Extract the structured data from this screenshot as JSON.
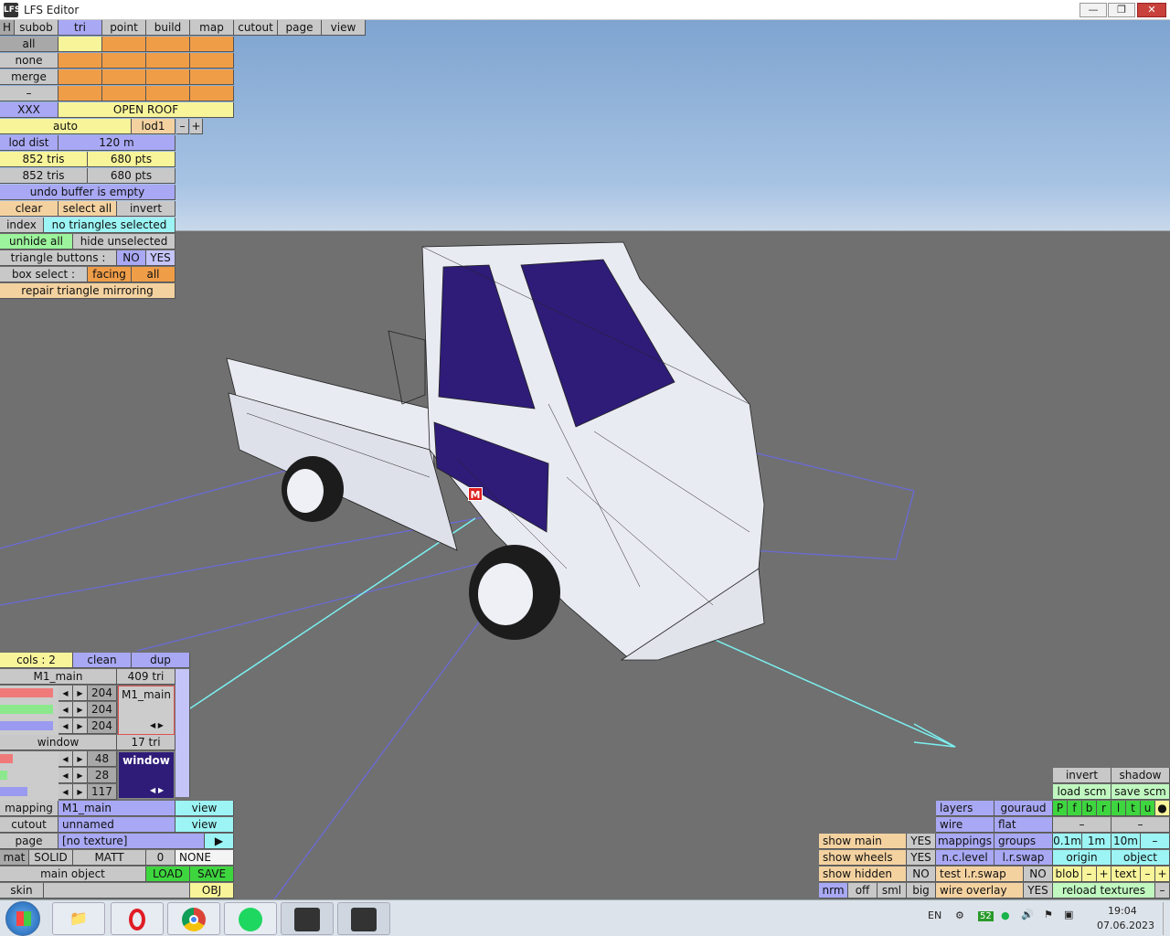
{
  "window": {
    "title": "LFS Editor",
    "icon": "lfs-app-icon",
    "minimize": "—",
    "restore": "❐",
    "close": "✕"
  },
  "menu": {
    "h": "H",
    "items": [
      "subob",
      "tri",
      "point",
      "build",
      "map",
      "cutout",
      "page",
      "view"
    ]
  },
  "left_panel": {
    "all": "all",
    "none": "none",
    "merge": "merge",
    "dash": "–",
    "xxx": "XXX",
    "open_roof": "OPEN ROOF",
    "auto": "auto",
    "lod1": "lod1",
    "minus": "–",
    "plus": "+",
    "lod_dist_label": "lod dist",
    "lod_dist_value": "120 m",
    "tris1": "852 tris",
    "pts1": "680 pts",
    "tris2": "852 tris",
    "pts2": "680 pts",
    "undo": "undo buffer is empty",
    "clear": "clear",
    "select_all": "select all",
    "invert": "invert",
    "index": "index",
    "no_selection": "no triangles selected",
    "unhide_all": "unhide all",
    "hide_unselected": "hide unselected",
    "triangle_buttons": "triangle buttons :",
    "no": "NO",
    "yes": "YES",
    "box_select": "box select :",
    "facing": "facing",
    "all2": "all",
    "repair": "repair triangle mirroring"
  },
  "materials": {
    "cols": "cols : 2",
    "clean": "clean",
    "dup": "dup",
    "m1_name": "M1_main",
    "m1_tri": "409 tri",
    "m1_r": "204",
    "m1_g": "204",
    "m1_b": "204",
    "m1_preview": "M1_main",
    "w_name": "window",
    "w_tri": "17 tri",
    "w_r": "48",
    "w_g": "28",
    "w_b": "117",
    "w_preview": "window",
    "mapping_label": "mapping",
    "mapping_value": "M1_main",
    "view1": "view",
    "cutout_label": "cutout",
    "cutout_value": "unnamed",
    "view2": "view",
    "page_label": "page",
    "page_value": "[no texture]",
    "page_arrow": "▶",
    "mat": "mat",
    "solid": "SOLID",
    "matt": "MATT",
    "zero": "0",
    "none": "NONE",
    "main_object": "main object",
    "load": "LOAD",
    "save": "SAVE",
    "skin": "skin",
    "obj": "OBJ"
  },
  "right_panel": {
    "invert": "invert",
    "shadow": "shadow",
    "load_scm": "load scm",
    "save_scm": "save scm",
    "layers": "layers",
    "gouraud": "gouraud",
    "letters": [
      "P",
      "f",
      "b",
      "r",
      "l",
      "t",
      "u",
      "●"
    ],
    "wire": "wire",
    "flat": "flat",
    "dash1": "–",
    "dash2": "–",
    "show_main": "show main",
    "yes1": "YES",
    "mappings": "mappings",
    "groups": "groups",
    "d01": "0.1m",
    "d1": "1m",
    "d10": "10m",
    "dm": "–",
    "show_wheels": "show wheels",
    "yes2": "YES",
    "nclevel": "n.c.level",
    "lrswap": "l.r.swap",
    "origin": "origin",
    "object": "object",
    "show_hidden": "show hidden",
    "no1": "NO",
    "test_lrswap": "test l.r.swap",
    "no2": "NO",
    "blob": "blob",
    "bm": "–",
    "bp": "+",
    "text": "text",
    "tm": "–",
    "tp": "+",
    "nrm": "nrm",
    "off": "off",
    "sml": "sml",
    "big": "big",
    "wire_overlay": "wire overlay",
    "yes3": "YES",
    "reload": "reload textures",
    "rd": "–"
  },
  "marker": "M",
  "taskbar": {
    "lang": "EN",
    "badge": "52",
    "time": "19:04",
    "date": "07.06.2023"
  },
  "colors": {
    "window_mat": "#2e1c78",
    "truck": "#e9ebf2",
    "sky": "#9ab8dc",
    "ground": "#707070",
    "axis": "#7cf0f0",
    "grid": "#6a6ad8"
  }
}
